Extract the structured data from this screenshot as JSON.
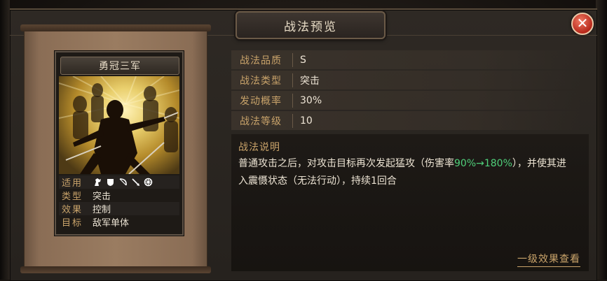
{
  "dialog": {
    "title": "战法预览",
    "close_label": "✕"
  },
  "card": {
    "name": "勇冠三军",
    "rows": [
      {
        "key": "适用",
        "value": ""
      },
      {
        "key": "类型",
        "value": "突击"
      },
      {
        "key": "效果",
        "value": "控制"
      },
      {
        "key": "目标",
        "value": "敌军单体"
      }
    ],
    "troop_icons": [
      "cavalry-icon",
      "shield-icon",
      "bow-icon",
      "spear-icon",
      "wheel-icon"
    ]
  },
  "stats": [
    {
      "label": "战法品质",
      "value": "S"
    },
    {
      "label": "战法类型",
      "value": "突击"
    },
    {
      "label": "发动概率",
      "value": "30%"
    },
    {
      "label": "战法等级",
      "value": "10"
    }
  ],
  "description": {
    "label": "战法说明",
    "text_prefix": "普通攻击之后，对攻击目标再次发起猛攻（伤害率",
    "highlight": "90%→180%",
    "text_suffix": "），并使其进入震慑状态（无法行动），持续1回合"
  },
  "footer": {
    "link_label": "一级效果查看"
  },
  "colors": {
    "accent": "#c9a36a",
    "highlight": "#4fcf7a",
    "close": "#c0392b"
  }
}
